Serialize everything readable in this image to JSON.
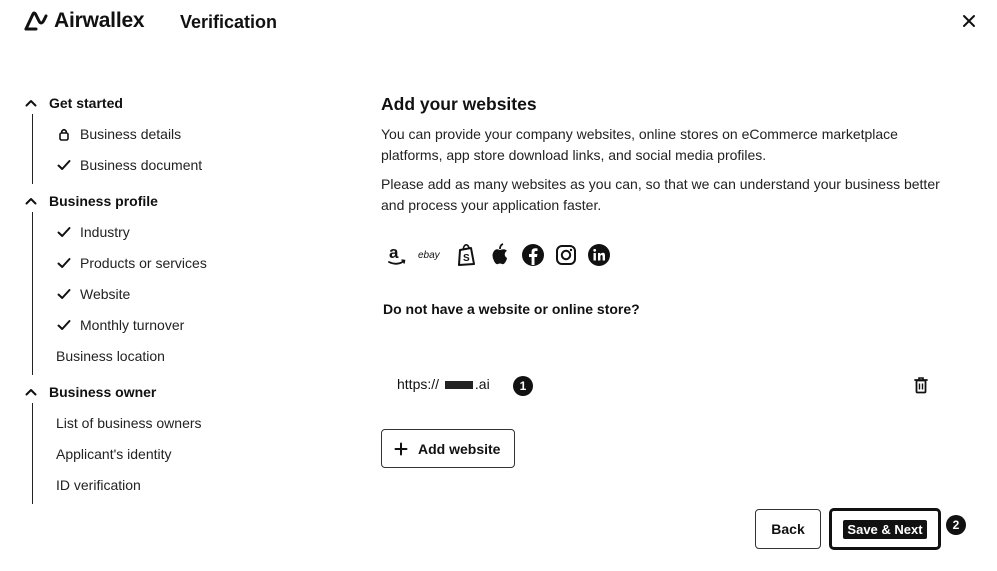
{
  "header": {
    "logo_text": "Airwallex",
    "title": "Verification",
    "close_icon": "close-icon"
  },
  "sidebar": {
    "sections": [
      {
        "title": "Get started",
        "items": [
          {
            "label": "Business details",
            "icon": "lock-icon"
          },
          {
            "label": "Business document",
            "icon": "check-icon"
          }
        ]
      },
      {
        "title": "Business profile",
        "items": [
          {
            "label": "Industry",
            "icon": "check-icon"
          },
          {
            "label": "Products or services",
            "icon": "check-icon"
          },
          {
            "label": "Website",
            "icon": "check-icon"
          },
          {
            "label": "Monthly turnover",
            "icon": "check-icon"
          },
          {
            "label": "Business location",
            "icon": ""
          }
        ]
      },
      {
        "title": "Business owner",
        "items": [
          {
            "label": "List of business owners",
            "icon": ""
          },
          {
            "label": "Applicant's identity",
            "icon": ""
          },
          {
            "label": "ID verification",
            "icon": ""
          }
        ]
      }
    ]
  },
  "main": {
    "title": "Add your websites",
    "desc1": "You can provide your company websites, online stores on eCommerce marketplace platforms, app store download links, and social media profiles.",
    "desc2": "Please add as many websites as you can, so that we can understand your business better and process your application faster.",
    "brands": [
      "amazon-icon",
      "ebay-icon",
      "shopify-icon",
      "apple-icon",
      "facebook-icon",
      "instagram-icon",
      "linkedin-icon"
    ],
    "ebay_text": "ebay",
    "no_website_link": "Do not have a website or online store?",
    "url_prefix": "https://",
    "url_suffix": ".ai",
    "badge1": "1",
    "add_website_label": "Add website"
  },
  "footer": {
    "back_label": "Back",
    "save_label": "Save & Next",
    "badge2": "2"
  }
}
